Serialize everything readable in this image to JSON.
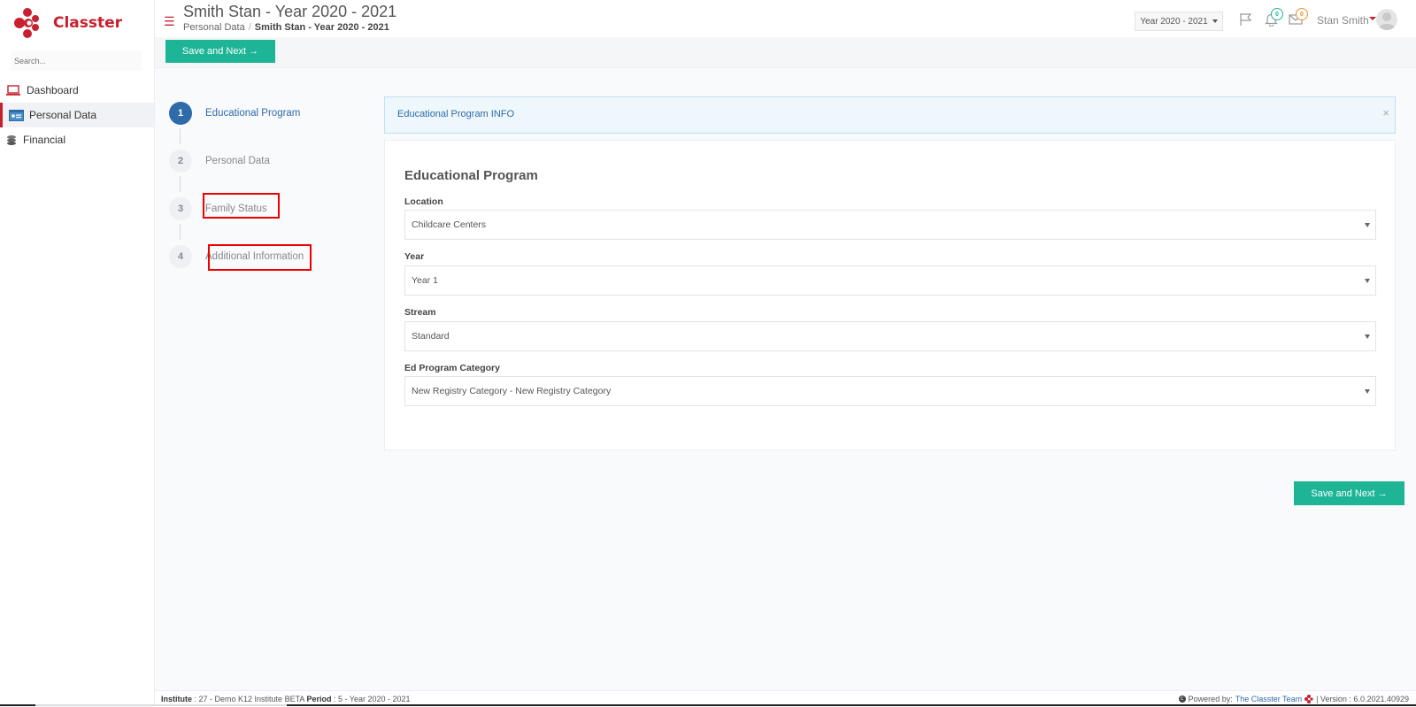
{
  "app": {
    "brand": "Classter"
  },
  "sidebar": {
    "search_placeholder": "Search...",
    "items": [
      {
        "label": "Dashboard",
        "icon": "laptop-icon"
      },
      {
        "label": "Personal Data",
        "icon": "id-card-icon",
        "active": true
      },
      {
        "label": "Financial",
        "icon": "coins-icon"
      }
    ]
  },
  "header": {
    "title": "Smith Stan - Year 2020 - 2021",
    "breadcrumb": {
      "parent": "Personal Data",
      "separator": "/",
      "current": "Smith Stan - Year 2020 - 2021"
    },
    "year_select": "Year 2020 - 2021",
    "notifications_count": "0",
    "messages_count": "0",
    "user_name": "Stan Smith"
  },
  "toolbar": {
    "save_next_label": "Save and Next →"
  },
  "stepper": {
    "steps": [
      {
        "number": "1",
        "label": "Educational Program",
        "active": true
      },
      {
        "number": "2",
        "label": "Personal Data"
      },
      {
        "number": "3",
        "label": "Family Status"
      },
      {
        "number": "4",
        "label": "Additional Information"
      }
    ]
  },
  "info": {
    "text": "Educational Program INFO",
    "close": "×"
  },
  "form": {
    "title": "Educational Program",
    "fields": [
      {
        "label": "Location",
        "value": "Childcare Centers"
      },
      {
        "label": "Year",
        "value": "Year 1"
      },
      {
        "label": "Stream",
        "value": "Standard"
      },
      {
        "label": "Ed Program Category",
        "value": "New Registry Category - New Registry Category"
      }
    ]
  },
  "bottom_button": {
    "label": "Save and Next →"
  },
  "footer": {
    "institute_label": "Institute",
    "institute_value": ": 27 - Demo K12 Institute BETA",
    "period_label": "Period",
    "period_value": ": 5 - Year 2020 - 2021",
    "powered_by": "Powered by:",
    "team_link": "The Classter Team",
    "version": "| Version : 6.0.2021.40929"
  },
  "colors": {
    "brand_red": "#c8202f",
    "accent_green": "#1eb597",
    "accent_blue": "#2f6ba8"
  }
}
